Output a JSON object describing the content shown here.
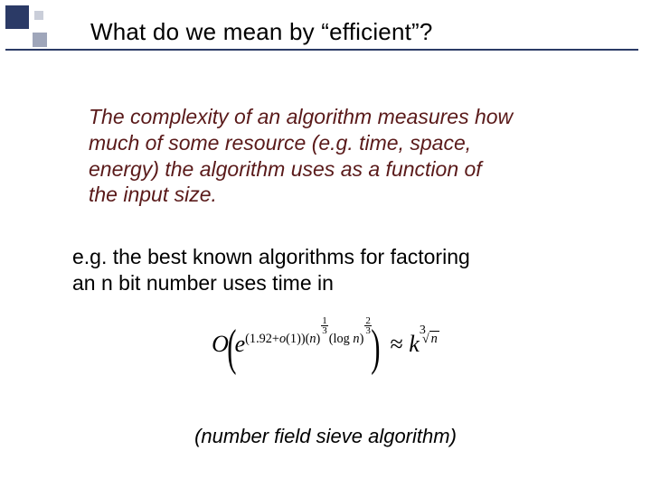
{
  "slide": {
    "title": "What do we mean by “efficient”?",
    "definition": "The complexity of an algorithm measures how much of some resource (e.g. time, space, energy) the algorithm uses as a function of the input size.",
    "example_intro": "e.g. the best known algorithms for factoring an n bit number uses time in",
    "caption": "(number field sieve algorithm)",
    "formula": {
      "latex": "O\\!\\left(e^{(1.92+o(1))(n)^{1/3}(\\log n)^{2/3}}\\right) \\approx k^{\\sqrt[3]{n}}",
      "lead": "O",
      "exp_const": "(1.92+",
      "little_o": "o",
      "exp_mid": "(1))(",
      "var_n": "n",
      "exp_close_n": ")",
      "log": "log",
      "approx": "≈",
      "k": "k",
      "cube_root_idx": "3",
      "radical": "√",
      "frac13_n": "1",
      "frac13_d": "3",
      "frac23_n": "2",
      "frac23_d": "3"
    }
  }
}
